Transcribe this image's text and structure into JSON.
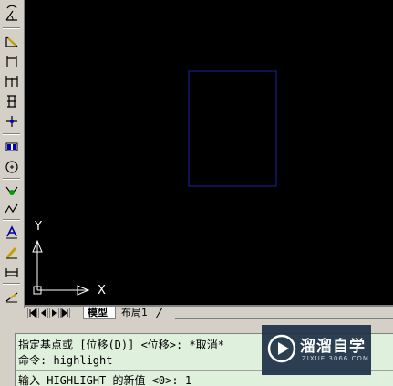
{
  "layout_tabs": [
    {
      "label": "模型",
      "active": true
    },
    {
      "label": "布局1",
      "active": false
    }
  ],
  "ucs": {
    "y_label": "Y",
    "x_label": "X"
  },
  "command_window": {
    "history": [
      "指定基点或 [位移(D)] <位移>:  *取消*",
      "命令: highlight"
    ],
    "prompt": "输入 HIGHLIGHT 的新值 <0>: 1"
  },
  "watermark": {
    "title": "溜溜自学",
    "subtitle": "ZIXUE.3066.COM"
  },
  "colors": {
    "canvas_bg": "#000000",
    "rectangle_stroke": "#1a1a8c",
    "command_bg": "#dff0dc",
    "toolbar_bg": "#d4d0c8"
  },
  "toolbar_icons": [
    "arc-icon",
    "angle-icon",
    "dim-angular-icon",
    "dim-linear-icon",
    "dim-baseline-icon",
    "dim-continue-icon",
    "dim-ordinate-icon",
    "tolerance-icon",
    "center-mark-icon",
    "dim-edit-icon",
    "leader-icon",
    "text-icon",
    "edit-text-icon",
    "dim-update-icon",
    "dim-style-icon",
    "oblique-icon"
  ]
}
